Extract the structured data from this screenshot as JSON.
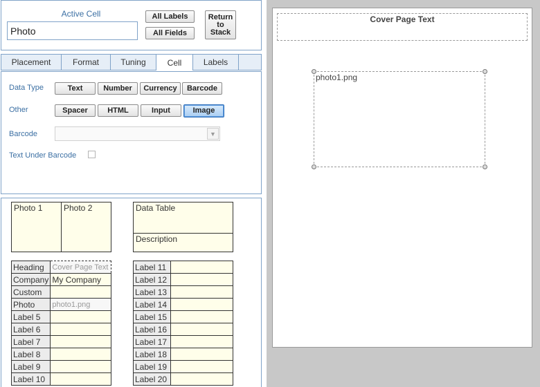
{
  "active_cell": {
    "title": "Active Cell",
    "value": "Photo",
    "all_labels": "All Labels",
    "all_fields": "All Fields",
    "return_line1": "Return",
    "return_line2": "to",
    "return_line3": "Stack"
  },
  "tabs": [
    "Placement",
    "Format",
    "Tuning",
    "Cell",
    "Labels"
  ],
  "active_tab": "Cell",
  "cell_panel": {
    "data_type_label": "Data Type",
    "data_types": [
      "Text",
      "Number",
      "Currency",
      "Barcode"
    ],
    "other_label": "Other",
    "others": [
      "Spacer",
      "HTML",
      "Input",
      "Image"
    ],
    "selected_other": "Image",
    "barcode_label": "Barcode",
    "barcode_value": "",
    "text_under_barcode_label": "Text Under Barcode",
    "text_under_barcode_checked": false
  },
  "layout": {
    "photo1": "Photo 1",
    "photo2": "Photo 2",
    "data_table": "Data Table",
    "description": "Description",
    "fields": [
      {
        "name": "Heading",
        "value": "Cover Page Text"
      },
      {
        "name": "Company",
        "value": "My Company"
      },
      {
        "name": "Custom",
        "value": ""
      },
      {
        "name": "Photo",
        "value": "photo1.png"
      },
      {
        "name": "Label 5",
        "value": ""
      },
      {
        "name": "Label 6",
        "value": ""
      },
      {
        "name": "Label 7",
        "value": ""
      },
      {
        "name": "Label 8",
        "value": ""
      },
      {
        "name": "Label 9",
        "value": ""
      },
      {
        "name": "Label 10",
        "value": ""
      }
    ],
    "labels_right": [
      {
        "name": "Label 11",
        "value": ""
      },
      {
        "name": "Label 12",
        "value": ""
      },
      {
        "name": "Label 13",
        "value": ""
      },
      {
        "name": "Label 14",
        "value": ""
      },
      {
        "name": "Label 15",
        "value": ""
      },
      {
        "name": "Label 16",
        "value": ""
      },
      {
        "name": "Label 17",
        "value": ""
      },
      {
        "name": "Label 18",
        "value": ""
      },
      {
        "name": "Label 19",
        "value": ""
      },
      {
        "name": "Label 20",
        "value": ""
      }
    ]
  },
  "preview": {
    "cover_text": "Cover Page Text",
    "image_name": "photo1.png"
  },
  "colors": {
    "accent": "#3b6fa3",
    "panel_border": "#7fa2c8",
    "cell_fill": "#fffeea",
    "selected_button": "#a9cdf2"
  }
}
